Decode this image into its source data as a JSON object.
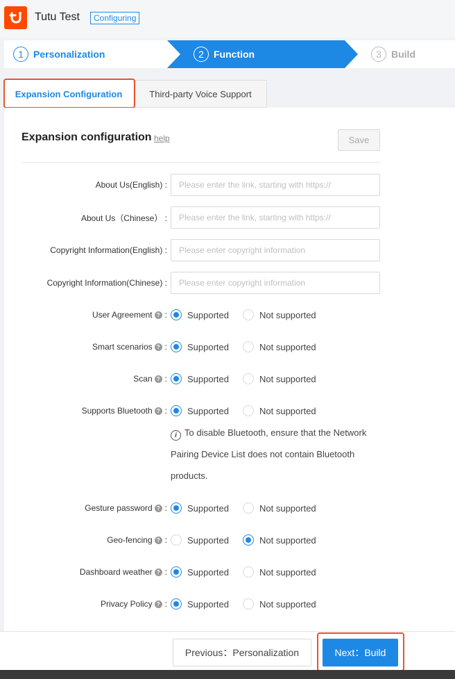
{
  "header": {
    "app_title": "Tutu Test",
    "status_badge": "Configuring",
    "logo_icon": "tuya-logo-icon",
    "brand_color": "#ff4800"
  },
  "steps": [
    {
      "number": "1",
      "label": "Personalization",
      "state": "done"
    },
    {
      "number": "2",
      "label": "Function",
      "state": "active"
    },
    {
      "number": "3",
      "label": "Build",
      "state": "pending"
    }
  ],
  "tabs": [
    {
      "label": "Expansion Configuration",
      "active": true
    },
    {
      "label": "Third-party Voice Support",
      "active": false
    }
  ],
  "section": {
    "title": "Expansion configuration",
    "help": "help",
    "save": "Save"
  },
  "text_fields": [
    {
      "label": "About Us(English) :",
      "value": "",
      "placeholder": "Please enter the link, starting with https://"
    },
    {
      "label": "About Us（Chinese） :",
      "value": "",
      "placeholder": "Please enter the link, starting with https://"
    },
    {
      "label": "Copyright Information(English) :",
      "value": "",
      "placeholder": "Please enter copyright information"
    },
    {
      "label": "Copyright Information(Chinese) :",
      "value": "",
      "placeholder": "Please enter copyright information"
    }
  ],
  "radio_labels": {
    "supported": "Supported",
    "not_supported": "Not supported"
  },
  "radio_fields": [
    {
      "label": "User Agreement",
      "selected": "supported"
    },
    {
      "label": "Smart scenarios",
      "selected": "supported"
    },
    {
      "label": "Scan",
      "selected": "supported"
    },
    {
      "label": "Supports Bluetooth",
      "selected": "supported"
    },
    {
      "label": "Gesture password",
      "selected": "supported"
    },
    {
      "label": "Geo-fencing",
      "selected": "not_supported"
    },
    {
      "label": "Dashboard weather",
      "selected": "supported"
    },
    {
      "label": "Privacy Policy",
      "selected": "supported"
    }
  ],
  "bluetooth_note": "To disable Bluetooth, ensure that the Network Pairing Device List does not contain Bluetooth products.",
  "footer": {
    "previous": "Previous：Personalization",
    "next": "Next：Build"
  },
  "colors": {
    "accent": "#1e88e5",
    "highlight": "#e8552b"
  }
}
